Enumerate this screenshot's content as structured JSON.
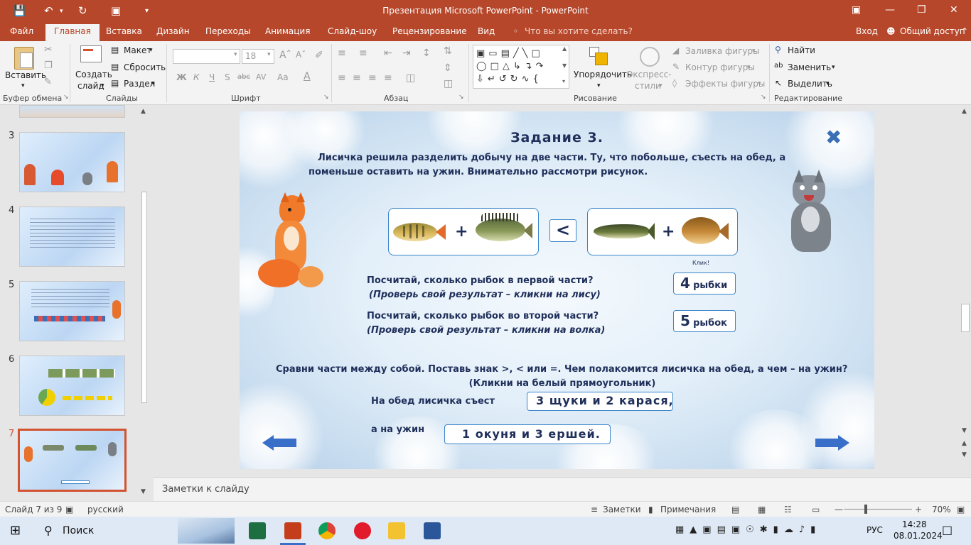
{
  "window": {
    "title": "Презентация Microsoft PowerPoint - PowerPoint"
  },
  "tabs": [
    "Файл",
    "Главная",
    "Вставка",
    "Дизайн",
    "Переходы",
    "Анимация",
    "Слайд-шоу",
    "Рецензирование",
    "Вид"
  ],
  "tell_me": "Что вы хотите сделать?",
  "account": {
    "signin": "Вход",
    "share": "Общий доступ"
  },
  "ribbon": {
    "clipboard": {
      "paste": "Вставить",
      "group": "Буфер обмена"
    },
    "slides": {
      "new_slide_1": "Создать",
      "new_slide_2": "слайд",
      "layout": "Макет",
      "reset": "Сбросить",
      "section": "Раздел",
      "group": "Слайды"
    },
    "font": {
      "size": "18",
      "bold": "Ж",
      "italic": "К",
      "underline": "Ч",
      "shadow": "S",
      "strike": "abc",
      "spacing": "AV",
      "case": "Aa",
      "group": "Шрифт"
    },
    "paragraph": {
      "group": "Абзац"
    },
    "drawing": {
      "arrange_1": "Упорядочить",
      "quick_styles_1": "Экспресс-",
      "quick_styles_2": "стили",
      "fill": "Заливка фигуры",
      "outline": "Контур фигуры",
      "effects": "Эффекты фигуры",
      "group": "Рисование"
    },
    "editing": {
      "find": "Найти",
      "replace": "Заменить",
      "select": "Выделить",
      "group": "Редактирование"
    }
  },
  "thumbnails": [
    {
      "num": "3"
    },
    {
      "num": "4"
    },
    {
      "num": "5"
    },
    {
      "num": "6"
    },
    {
      "num": "7"
    }
  ],
  "slide": {
    "title": "Задание  3.",
    "intro_1": "Лисичка решила разделить добычу на две части. Ту, что побольше, съесть на обед, а",
    "intro_2": "поменьше оставить на ужин. Внимательно рассмотри рисунок.",
    "plus": "+",
    "compare_sign": "<",
    "click_label": "Клик!",
    "q1": "Посчитай, сколько рыбок в первой части?",
    "q1_hint": "(Проверь свой результат – кликни на лису)",
    "a1_num": "4",
    "a1_word": "рыбки",
    "q2": "Посчитай, сколько рыбок во второй части?",
    "q2_hint": "(Проверь свой результат – кликни на волка)",
    "a2_num": "5",
    "a2_word": "рыбок",
    "compare_1": "Сравни части между собой. Поставь знак  >, < или =. Чем полакомится лисичка на обед, а чем – на ужин?",
    "compare_2": "(Кликни на белый прямоугольник)",
    "lunch_label": "На обед лисичка съест",
    "lunch_answer": "3 щуки и 2 карася,",
    "dinner_label": "а на ужин",
    "dinner_answer": "1 окуня и 3 ершей.",
    "close_glyph": "✖"
  },
  "notes_placeholder": "Заметки к слайду",
  "status": {
    "slide": "Слайд 7 из 9",
    "lang": "русский",
    "notes": "Заметки",
    "comments": "Примечания",
    "zoom": "70%"
  },
  "taskbar": {
    "search": "Поиск",
    "lang": "РУС",
    "time": "14:28",
    "date": "08.01.2024"
  }
}
